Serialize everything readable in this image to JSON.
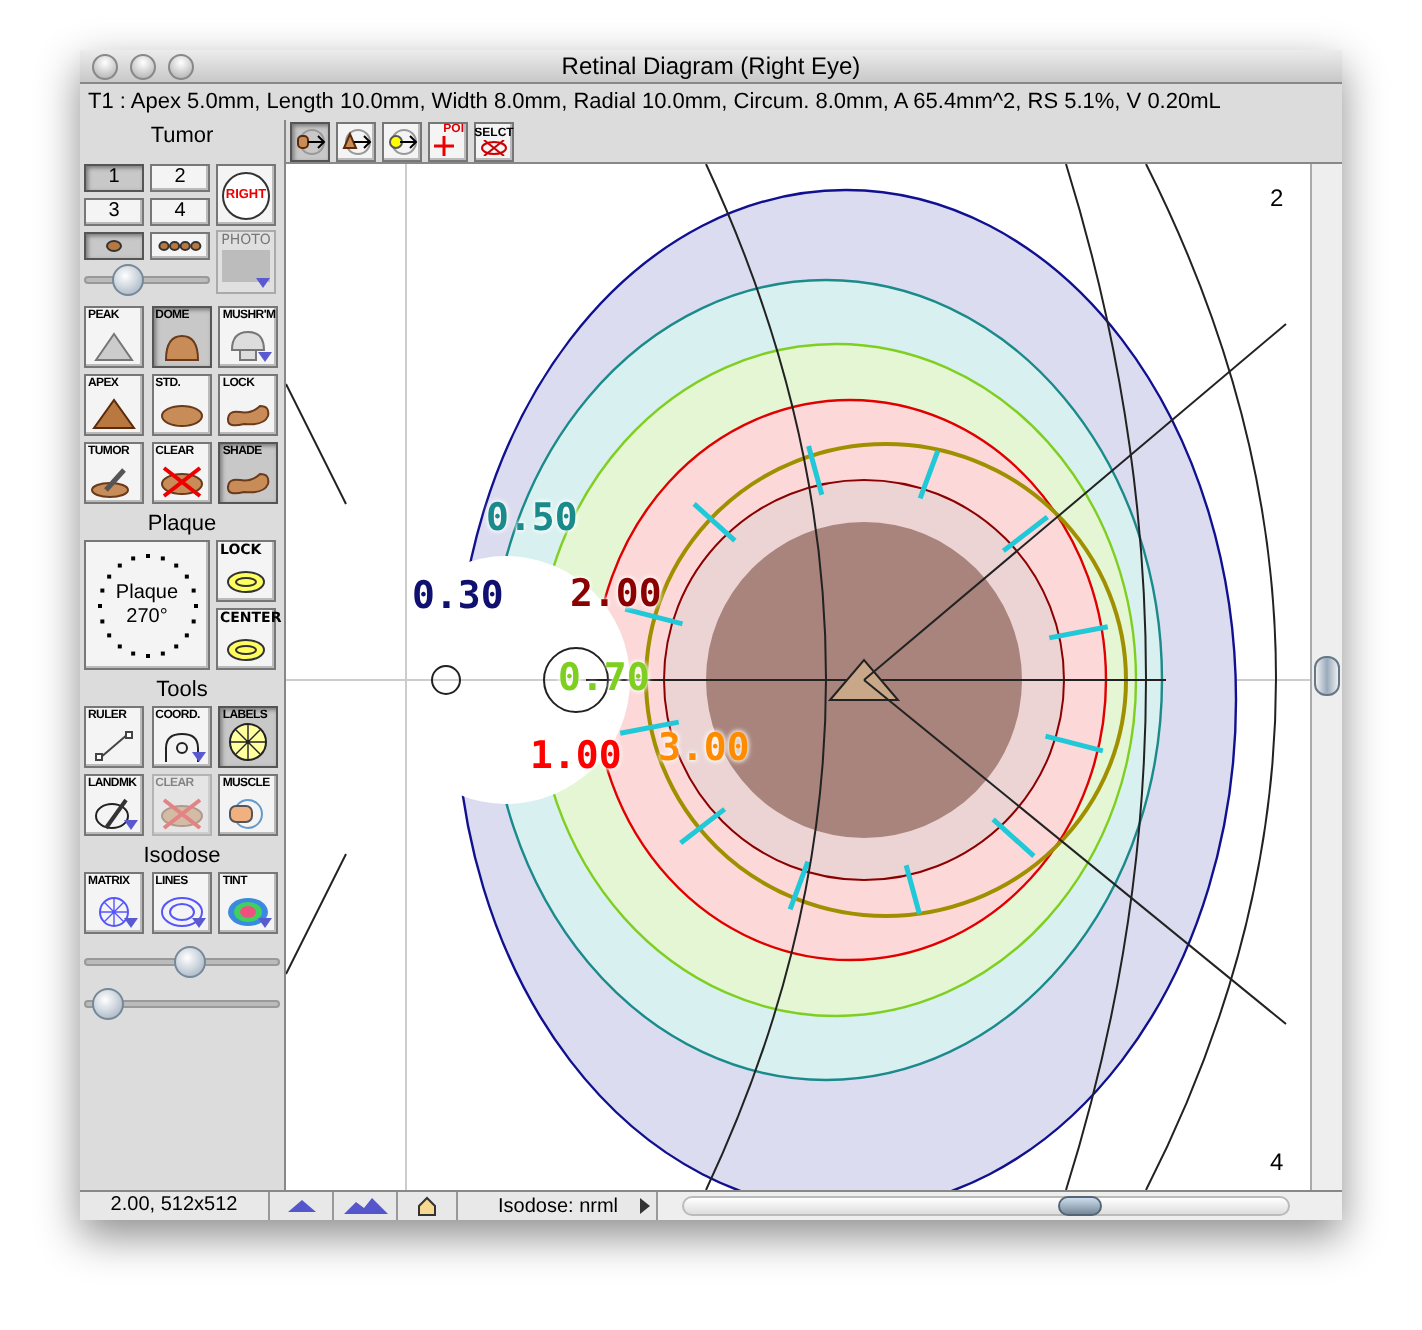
{
  "window": {
    "title": "Retinal Diagram (Right Eye)"
  },
  "info_line": "T1 : Apex 5.0mm, Length 10.0mm, Width 8.0mm, Radial 10.0mm, Circum. 8.0mm, A 65.4mm^2, RS 5.1%, V 0.20mL",
  "toolbar": [
    {
      "kind": "tumor-arrow",
      "selected": true
    },
    {
      "kind": "apex-arrow",
      "selected": false
    },
    {
      "kind": "point-arrow",
      "selected": false
    },
    {
      "kind": "poi",
      "label": "POI",
      "selected": false
    },
    {
      "kind": "select",
      "label": "SELCT",
      "selected": false
    }
  ],
  "tumor": {
    "heading": "Tumor",
    "numbers": [
      {
        "label": "1",
        "selected": true
      },
      {
        "label": "2",
        "selected": false
      },
      {
        "label": "3",
        "selected": false
      },
      {
        "label": "4",
        "selected": false
      }
    ],
    "eye_button": "RIGHT",
    "markers": [
      {
        "kind": "single",
        "selected": true
      },
      {
        "kind": "quad",
        "selected": false
      }
    ],
    "slider": {
      "level": 0.3
    },
    "photo_button": "PHOTO",
    "buttons": [
      {
        "label": "PEAK",
        "kind": "peak",
        "selected": false,
        "menu": false
      },
      {
        "label": "DOME",
        "kind": "dome",
        "selected": true,
        "menu": false
      },
      {
        "label": "MUSHR'M",
        "kind": "mushroom",
        "selected": false,
        "menu": true
      },
      {
        "label": "APEX",
        "kind": "apex",
        "selected": false,
        "menu": false
      },
      {
        "label": "STD.",
        "kind": "std",
        "selected": false,
        "menu": false
      },
      {
        "label": "LOCK",
        "kind": "lock",
        "selected": false,
        "menu": false
      },
      {
        "label": "TUMOR",
        "kind": "tumor",
        "selected": false,
        "menu": false
      },
      {
        "label": "CLEAR",
        "kind": "clear",
        "selected": false,
        "menu": false
      },
      {
        "label": "SHADE",
        "kind": "shade",
        "selected": true,
        "menu": false
      }
    ]
  },
  "plaque": {
    "heading": "Plaque",
    "dial_label": "Plaque",
    "dial_angle": "270°",
    "buttons": [
      {
        "label": "LOCK",
        "selected": false
      },
      {
        "label": "CENTER",
        "selected": false
      }
    ]
  },
  "tools": {
    "heading": "Tools",
    "buttons": [
      {
        "label": "RULER",
        "kind": "ruler",
        "selected": false,
        "disabled": false,
        "menu": false
      },
      {
        "label": "COORD.",
        "kind": "coord",
        "selected": false,
        "disabled": false,
        "menu": true
      },
      {
        "label": "LABELS",
        "kind": "labels",
        "selected": true,
        "disabled": false,
        "menu": false
      },
      {
        "label": "LANDMK",
        "kind": "landmark",
        "selected": false,
        "disabled": false,
        "menu": true
      },
      {
        "label": "CLEAR",
        "kind": "clear",
        "selected": false,
        "disabled": true,
        "menu": false
      },
      {
        "label": "MUSCLE",
        "kind": "muscle",
        "selected": false,
        "disabled": false,
        "menu": false
      }
    ]
  },
  "isodose": {
    "heading": "Isodose",
    "buttons": [
      {
        "label": "MATRIX",
        "kind": "matrix",
        "menu": true
      },
      {
        "label": "LINES",
        "kind": "lines",
        "menu": true
      },
      {
        "label": "TINT",
        "kind": "tint",
        "menu": true
      }
    ],
    "sliders": [
      {
        "level": 0.55
      },
      {
        "level": 0.05
      }
    ]
  },
  "diagram": {
    "corner_labels": [
      "2",
      "4"
    ],
    "isodose_labels": [
      {
        "text": "0.50",
        "color": "#1a8a8a"
      },
      {
        "text": "0.30",
        "color": "#101070"
      },
      {
        "text": "2.00",
        "color": "#8b0000"
      },
      {
        "text": "0.70",
        "color": "#7fcf20"
      },
      {
        "text": "1.00",
        "color": "#ff0000"
      },
      {
        "text": "3.00",
        "color": "#ff8c00"
      }
    ]
  },
  "status_bar": {
    "zoom": "2.00, 512x512",
    "isodose": "Isodose: nrml"
  }
}
